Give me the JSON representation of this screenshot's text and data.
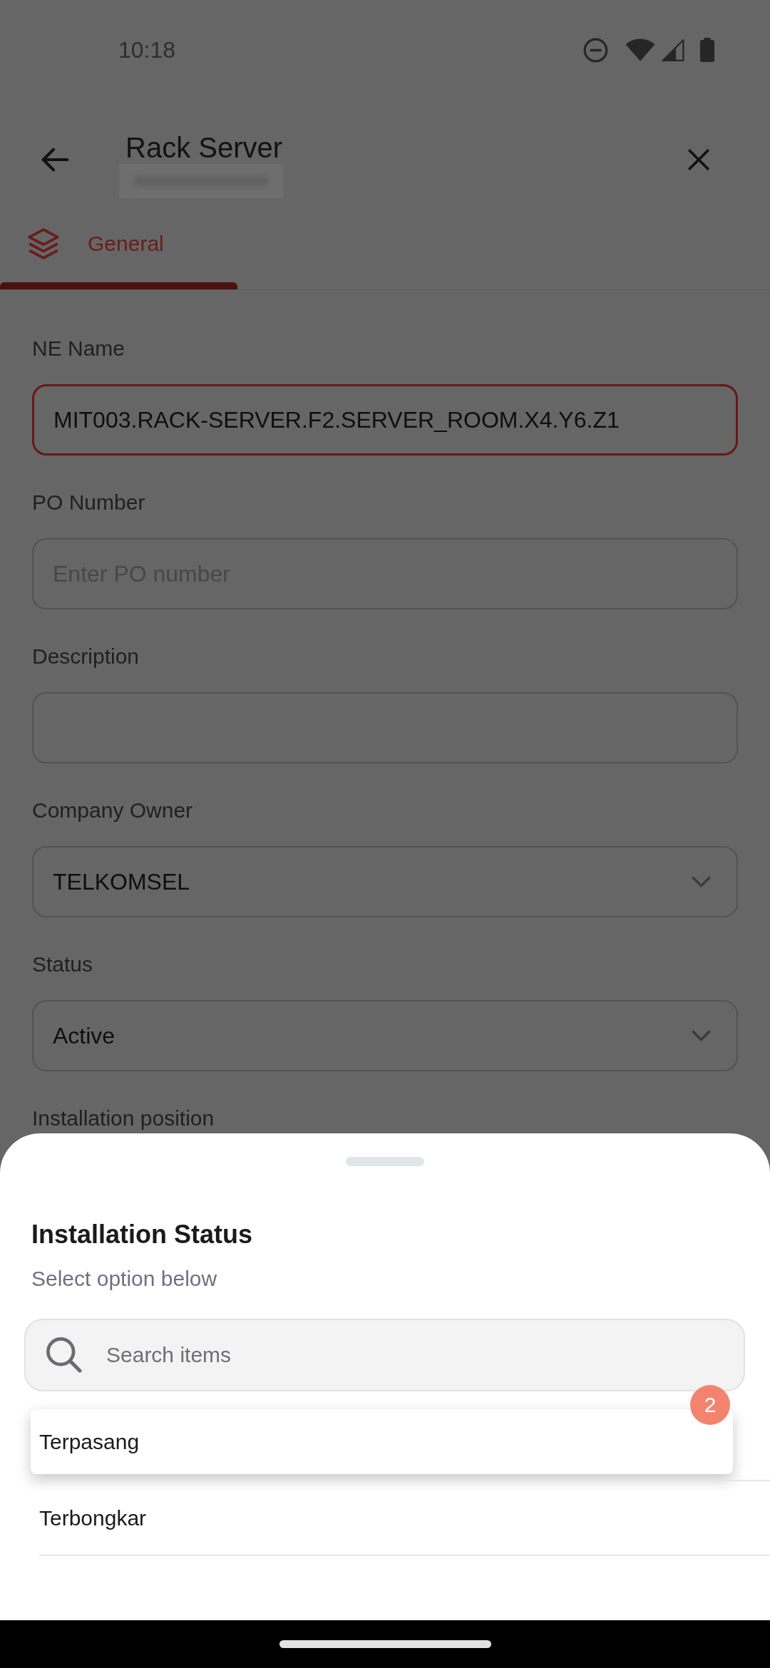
{
  "status_bar": {
    "time": "10:18"
  },
  "header": {
    "title": "Rack Server"
  },
  "tabs": [
    {
      "label": "General",
      "selected": true
    }
  ],
  "form": {
    "fields": [
      {
        "label": "NE Name",
        "kind": "text",
        "value": "MIT003.RACK-SERVER.F2.SERVER_ROOM.X4.Y6.Z1",
        "focused": true
      },
      {
        "label": "PO Number",
        "kind": "text",
        "placeholder": "Enter PO number",
        "focused": false
      },
      {
        "label": "Description",
        "kind": "text",
        "focused": false
      },
      {
        "label": "Company Owner",
        "kind": "dropdown",
        "value": "TELKOMSEL",
        "focused": false
      },
      {
        "label": "Status",
        "kind": "dropdown",
        "value": "Active",
        "focused": false
      }
    ],
    "covered_label": "Installation position"
  },
  "bottom_sheet": {
    "title": "Installation Status",
    "subtitle": "Select option below",
    "search": {
      "placeholder": "Search items"
    },
    "options": [
      {
        "label": "Terpasang",
        "selected": true,
        "badge": "2"
      },
      {
        "label": "Terbongkar",
        "selected": false
      }
    ]
  }
}
